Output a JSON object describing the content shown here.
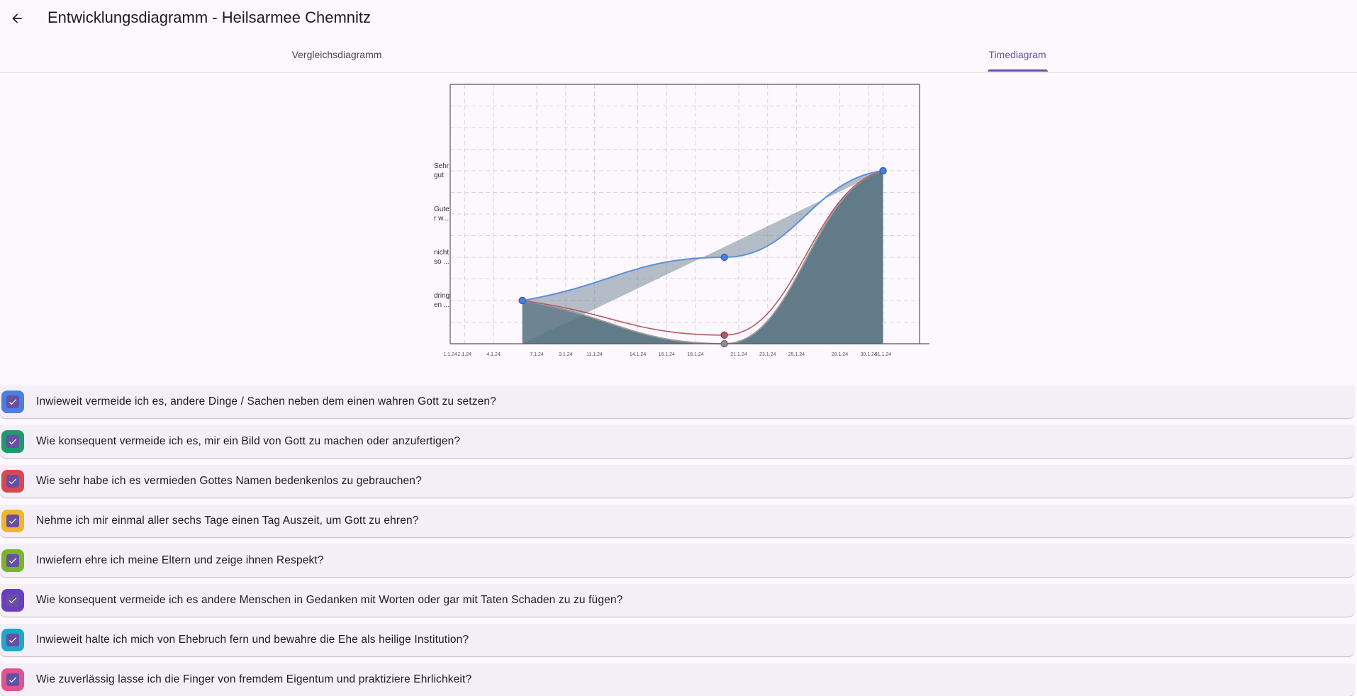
{
  "appbar": {
    "title": "Entwicklungsdiagramm - Heilsarmee Chemnitz",
    "back_icon": "arrow-left-icon"
  },
  "tabs": [
    {
      "label": "Vergleichsdiagramm",
      "active": false
    },
    {
      "label": "Timediagram",
      "active": true
    }
  ],
  "chart_data": {
    "type": "area",
    "y_labels": [
      {
        "level": 4,
        "text": [
          "Sehr",
          "gut"
        ]
      },
      {
        "level": 3,
        "text": [
          "Gute",
          "r w..."
        ]
      },
      {
        "level": 2,
        "text": [
          "nicht",
          "so ..."
        ]
      },
      {
        "level": 1,
        "text": [
          "dring",
          "en ..."
        ]
      }
    ],
    "x_tick_labels": [
      "1.1.24",
      "2.1.24",
      "4.1.24",
      "7.1.24",
      "9.1.24",
      "11.1.24",
      "14.1.24",
      "16.1.24",
      "18.1.24",
      "21.1.24",
      "23.1.24",
      "25.1.24",
      "28.1.24",
      "30.1.24",
      "31.1.24"
    ],
    "ylim": [
      0,
      6
    ],
    "grid": true,
    "series": [
      {
        "color": "#5b8fe0",
        "points": [
          {
            "x": "6.1.24",
            "y": 1
          },
          {
            "x": "20.1.24",
            "y": 2
          },
          {
            "x": "31.1.24",
            "y": 4
          }
        ]
      },
      {
        "color": "#b25b63",
        "points": [
          {
            "x": "6.1.24",
            "y": 1
          },
          {
            "x": "20.1.24",
            "y": 0.2
          },
          {
            "x": "31.1.24",
            "y": 4
          }
        ]
      },
      {
        "color": "#8a8a8a",
        "points": [
          {
            "x": "6.1.24",
            "y": 1
          },
          {
            "x": "20.1.24",
            "y": 0
          },
          {
            "x": "31.1.24",
            "y": 4
          }
        ]
      }
    ]
  },
  "questions": [
    {
      "text": "Inwieweit vermeide ich es, andere Dinge / Sachen neben dem einen wahren Gott zu setzen?",
      "color": "#4a7fe0"
    },
    {
      "text": "Wie konsequent vermeide ich es, mir ein Bild von Gott zu machen oder anzufertigen?",
      "color": "#1f9a6c"
    },
    {
      "text": "Wie sehr habe ich es vermieden Gottes Namen bedenkenlos zu gebrauchen?",
      "color": "#d9484f"
    },
    {
      "text": "Nehme ich mir einmal aller sechs Tage einen Tag Auszeit, um Gott zu ehren?",
      "color": "#f0b528"
    },
    {
      "text": "Inwiefern ehre ich meine Eltern und zeige ihnen Respekt?",
      "color": "#7cb32e"
    },
    {
      "text": "Wie konsequent vermeide ich es andere Menschen in Gedanken mit Worten oder gar mit Taten Schaden zu zu fügen?",
      "color": "#6a3fbf"
    },
    {
      "text": "Inwieweit halte ich mich von Ehebruch fern und bewahre die Ehe als heilige Institution?",
      "color": "#1fa8c9"
    },
    {
      "text": "Wie zuverlässig lasse ich die Finger von fremdem Eigentum und praktiziere Ehrlichkeit?",
      "color": "#e0538f"
    }
  ]
}
